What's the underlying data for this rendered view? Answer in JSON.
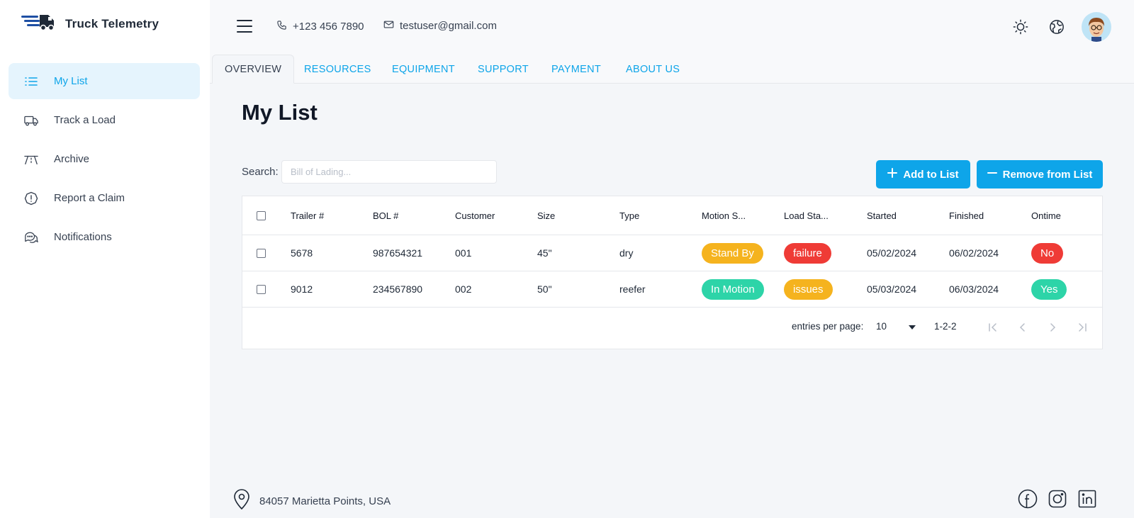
{
  "brand": {
    "name": "Truck Telemetry",
    "logo_icon": "truck-logo-icon"
  },
  "sidebar": {
    "items": [
      {
        "label": "My List",
        "icon": "list-icon",
        "active": true
      },
      {
        "label": "Track a Load",
        "icon": "truck-icon",
        "active": false
      },
      {
        "label": "Archive",
        "icon": "archive-road-icon",
        "active": false
      },
      {
        "label": "Report a Claim",
        "icon": "alert-circle-icon",
        "active": false
      },
      {
        "label": "Notifications",
        "icon": "chat-bubbles-icon",
        "active": false
      }
    ]
  },
  "header": {
    "phone": "+123 456 7890",
    "email": "testuser@gmail.com",
    "icons": [
      "menu-icon",
      "phone-icon",
      "mail-icon",
      "sun-icon",
      "globe-icon",
      "avatar"
    ]
  },
  "tabs": [
    {
      "label": "OVERVIEW",
      "active": true
    },
    {
      "label": "RESOURCES",
      "active": false
    },
    {
      "label": "EQUIPMENT",
      "active": false
    },
    {
      "label": "SUPPORT",
      "active": false
    },
    {
      "label": "PAYMENT",
      "active": false
    },
    {
      "label": "ABOUT US",
      "active": false
    }
  ],
  "main": {
    "title": "My List",
    "search": {
      "label": "Search:",
      "placeholder": "Bill of Lading...",
      "value": ""
    },
    "add_button": "Add to List",
    "remove_button": "Remove from List"
  },
  "table": {
    "columns": [
      "Trailer #",
      "BOL #",
      "Customer",
      "Size",
      "Type",
      "Motion S...",
      "Load Sta...",
      "Started",
      "Finished",
      "Ontime"
    ],
    "rows": [
      {
        "trailer": "5678",
        "bol": "987654321",
        "customer": "001",
        "size": "45\"",
        "type": "dry",
        "motion": "Stand By",
        "load": "failure",
        "started": "05/02/2024",
        "finished": "06/02/2024",
        "ontime": "No"
      },
      {
        "trailer": "9012",
        "bol": "234567890",
        "customer": "002",
        "size": "50\"",
        "type": "reefer",
        "motion": "In Motion",
        "load": "issues",
        "started": "05/03/2024",
        "finished": "06/03/2024",
        "ontime": "Yes"
      }
    ]
  },
  "pagination": {
    "label": "entries per page:",
    "per_page": "10",
    "range": "1-2-2"
  },
  "status_colors": {
    "Stand By": "#f5b31e",
    "In Motion": "#2dd4a8",
    "failure": "#ef3b36",
    "issues": "#f5b31e",
    "No": "#ef3b36",
    "Yes": "#2dd4a8"
  },
  "footer": {
    "address": "84057 Marietta Points, USA",
    "social": [
      "facebook-icon",
      "instagram-icon",
      "linkedin-icon"
    ]
  }
}
